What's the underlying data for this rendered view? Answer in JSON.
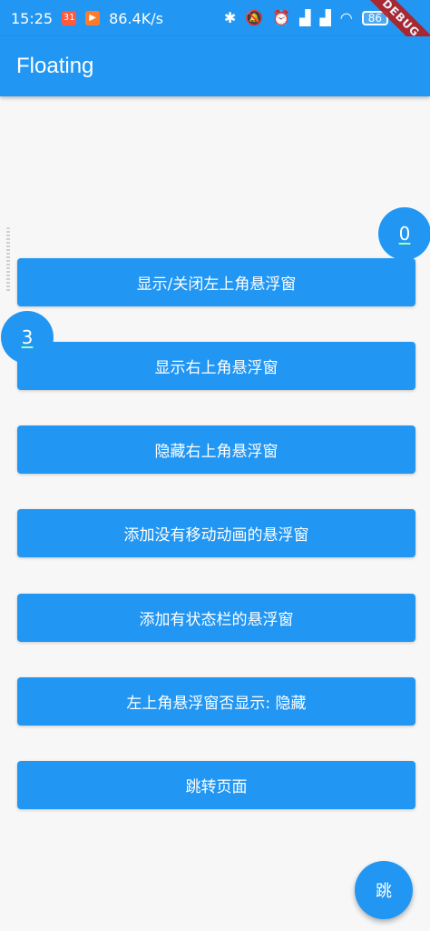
{
  "status_bar": {
    "time": "15:25",
    "badge_calendar": "31",
    "badge_video": "▶",
    "network_speed": "86.4K/s",
    "battery_level": "86",
    "icons": [
      "bluetooth-icon",
      "mute-icon",
      "alarm-icon",
      "signal-hd-icon",
      "signal-hd-icon",
      "wifi-icon",
      "battery-icon"
    ]
  },
  "debug_banner": "DEBUG",
  "app_bar": {
    "title": "Floating"
  },
  "floating_windows": {
    "top_right_counter": "0",
    "top_left_counter": "3"
  },
  "buttons": [
    {
      "label": "显示/关闭左上角悬浮窗"
    },
    {
      "label": "显示右上角悬浮窗"
    },
    {
      "label": "隐藏右上角悬浮窗"
    },
    {
      "label": "添加没有移动动画的悬浮窗"
    },
    {
      "label": "添加有状态栏的悬浮窗"
    },
    {
      "label": "左上角悬浮窗否显示: 隐藏"
    },
    {
      "label": "跳转页面"
    }
  ],
  "fab": {
    "label": "跳"
  },
  "colors": {
    "primary": "#2196f3",
    "background": "#f7f7f7",
    "debug": "#b71c1c"
  }
}
